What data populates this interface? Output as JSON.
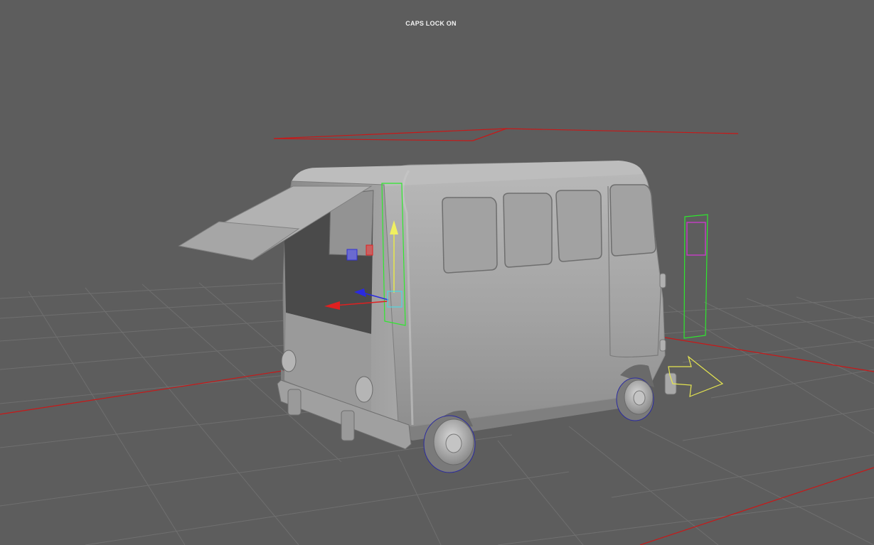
{
  "viewport": {
    "hud_message": "CAPS LOCK ON"
  },
  "colors": {
    "background": "#5d5d5d",
    "grid_line": "#6e6e6e",
    "axis_x": "#cc1a1a",
    "model_body": "#a9a9a9",
    "selection_green": "#2ee82e",
    "manipulator_y": "#e8e84a",
    "manipulator_x": "#e02020",
    "manipulator_z": "#2a2ae0",
    "control_yellow": "#e6e650",
    "control_magenta": "#c040c0"
  },
  "icons": {
    "move_manipulator": "move-manipulator-icon",
    "arrow_control": "arrow-control-icon"
  }
}
